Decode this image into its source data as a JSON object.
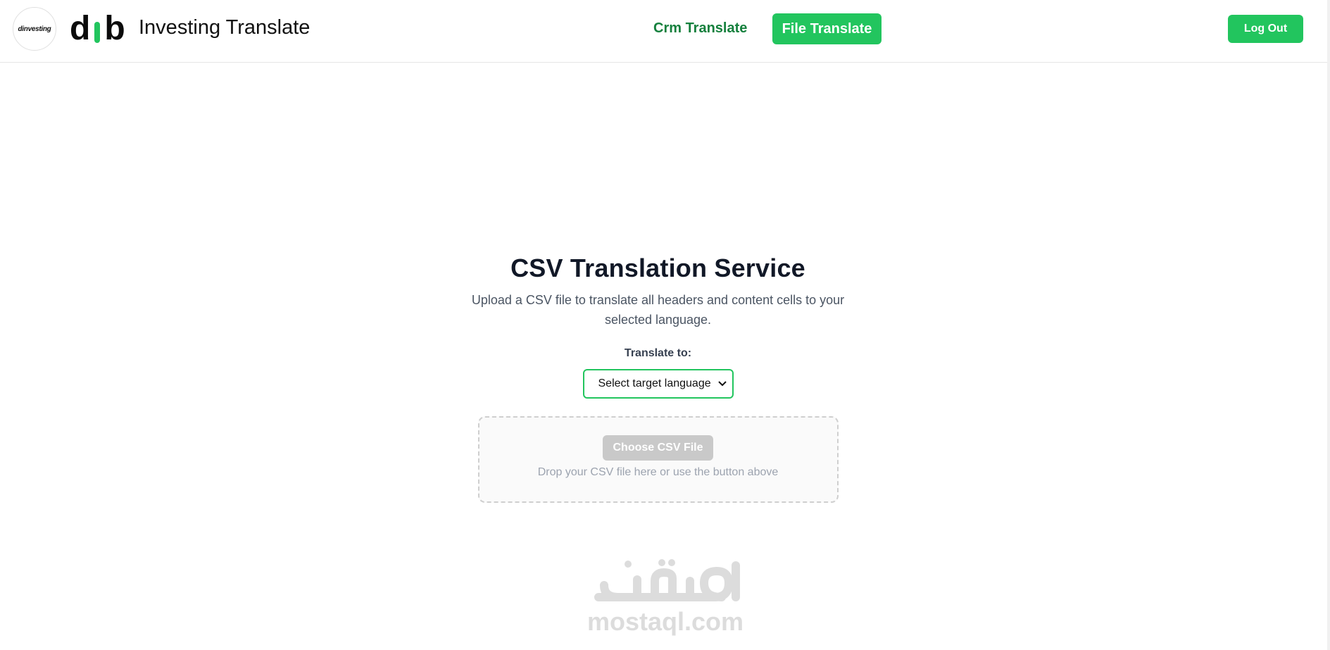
{
  "navbar": {
    "logo_small_text": "dinvesting",
    "logo_text_left": "d",
    "logo_text_right": "b",
    "brand_title": "Investing Translate",
    "links": [
      {
        "label": "Crm Translate",
        "active": false
      },
      {
        "label": "File Translate",
        "active": true
      }
    ],
    "logout_label": "Log Out"
  },
  "main": {
    "title": "CSV Translation Service",
    "subtitle": "Upload a CSV file to translate all headers and content cells to your selected language.",
    "language_label": "Translate to:",
    "language_select_value": "Select target language",
    "choose_button_label": "Choose CSV File",
    "drop_hint": "Drop your CSV file here or use the button above"
  },
  "watermark": {
    "text": "mostaql.com"
  },
  "colors": {
    "accent": "#22c55e",
    "accent_dark": "#15803d",
    "disabled": "#c9c9c9"
  }
}
